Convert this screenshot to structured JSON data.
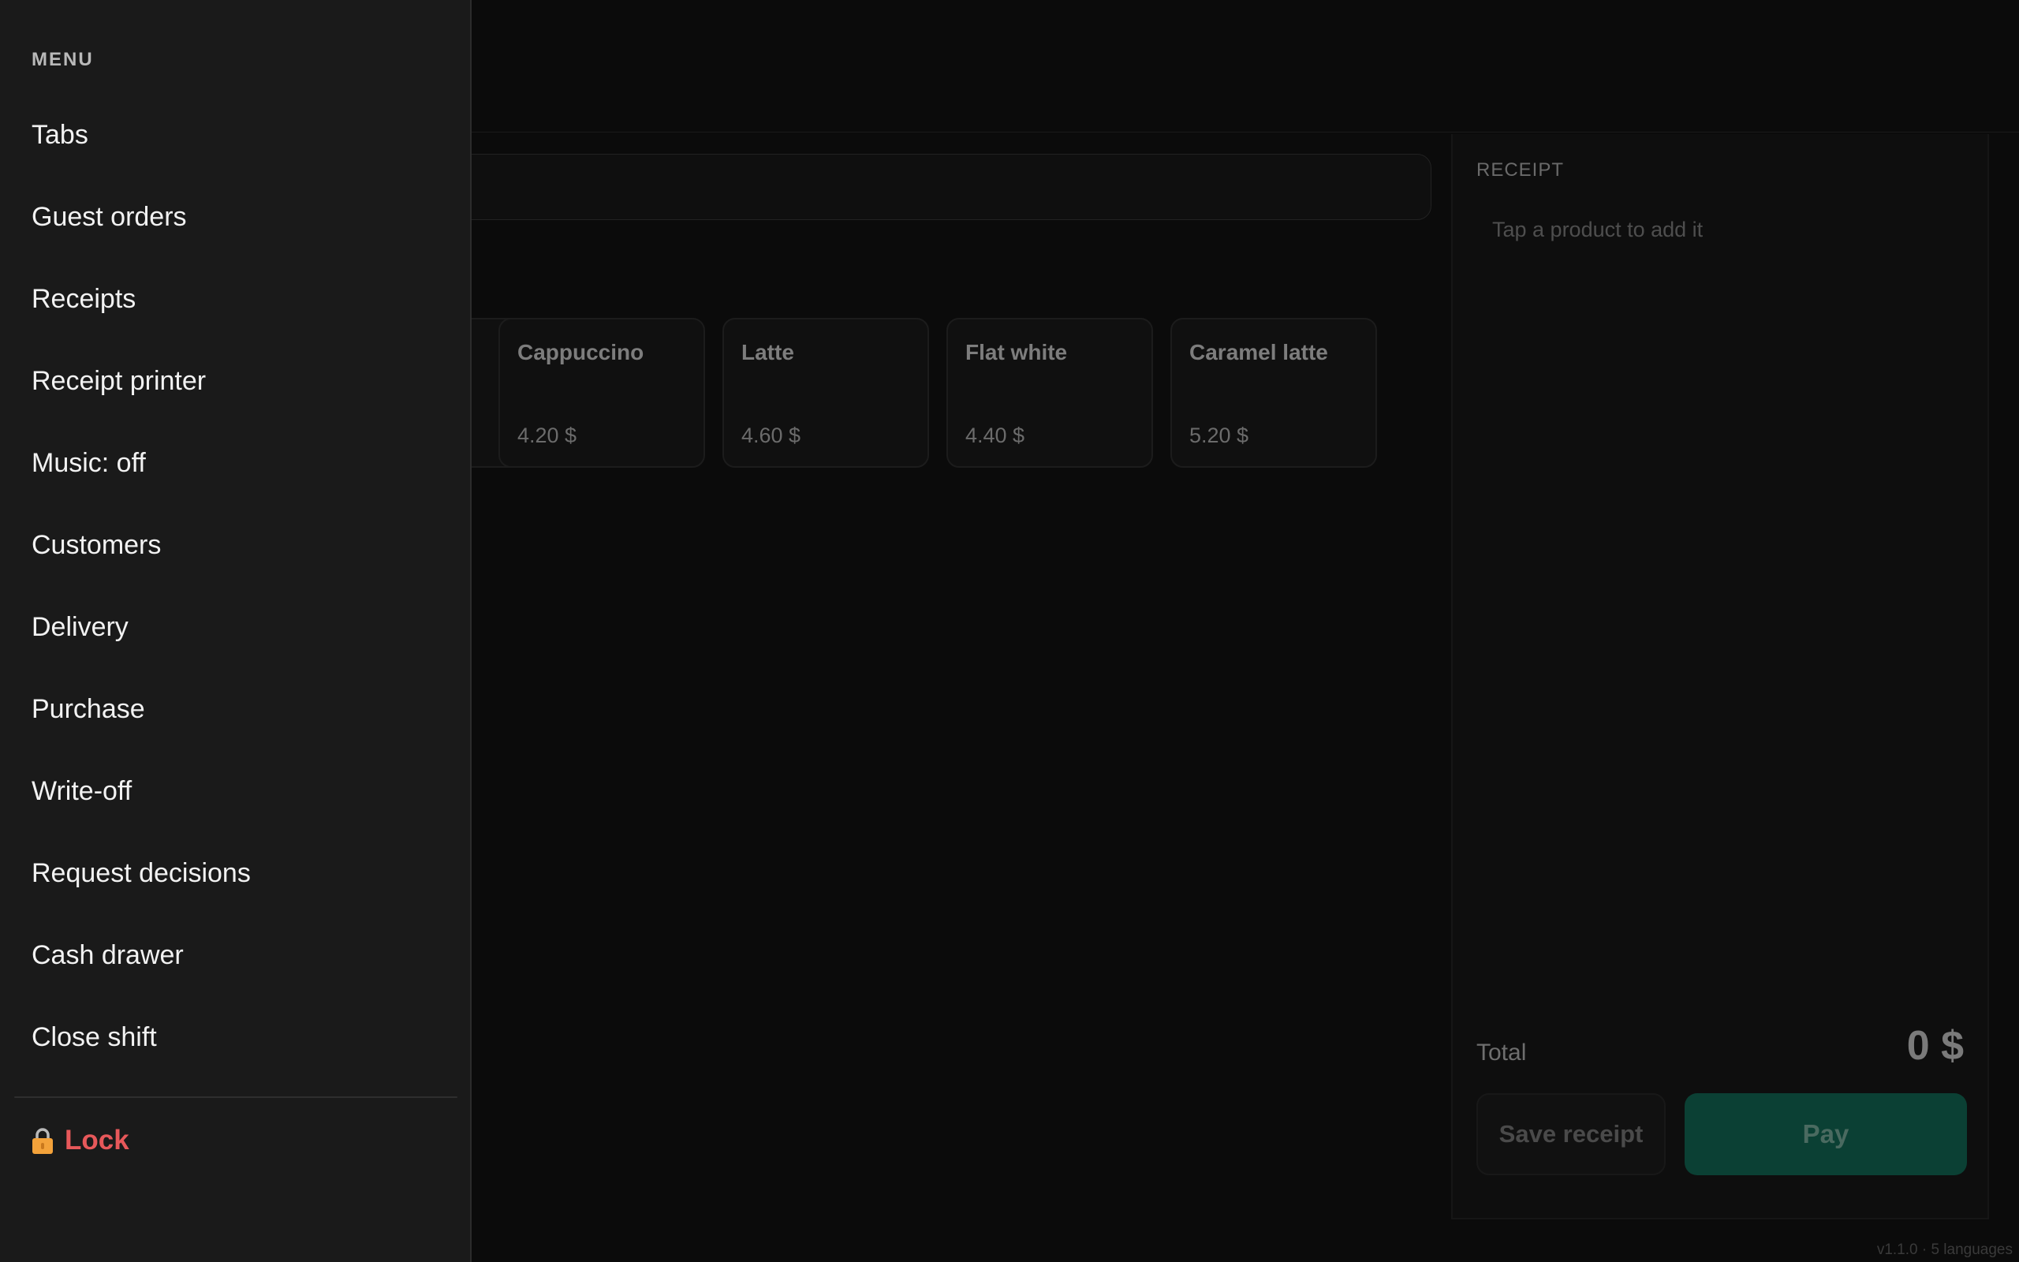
{
  "products": [
    {
      "name": "Cappuccino",
      "price": "4.20 $"
    },
    {
      "name": "Latte",
      "price": "4.60 $"
    },
    {
      "name": "Flat white",
      "price": "4.40 $"
    },
    {
      "name": "Caramel latte",
      "price": "5.20 $"
    }
  ],
  "receipt": {
    "title": "RECEIPT",
    "empty_hint": "Tap a product to add it",
    "total_label": "Total",
    "total_value": "0 $",
    "save_label": "Save receipt",
    "pay_label": "Pay"
  },
  "version": "v1.1.0 · 5 languages",
  "menu": {
    "heading": "MENU",
    "items": [
      "Tabs",
      "Guest orders",
      "Receipts",
      "Receipt printer",
      "Music: off",
      "Customers",
      "Delivery",
      "Purchase",
      "Write-off",
      "Request decisions",
      "Cash drawer",
      "Close shift"
    ],
    "lock_label": "Lock"
  },
  "colors": {
    "accent_pay": "#0b4034",
    "lock_red": "#e7585a",
    "lock_icon": "#f3a23a"
  },
  "icons": {
    "lock": "lock-icon"
  }
}
